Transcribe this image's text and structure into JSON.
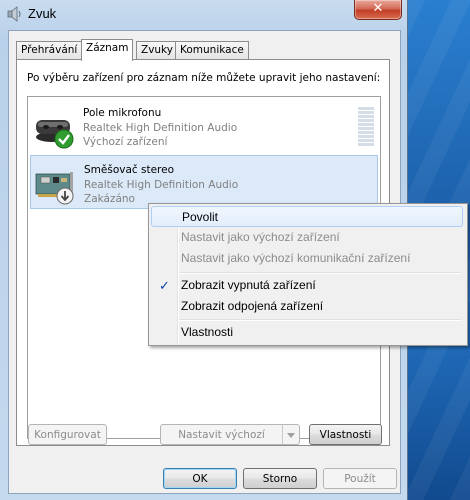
{
  "window": {
    "title": "Zvuk",
    "close_label": "✕"
  },
  "tabs": [
    {
      "label": "Přehrávání",
      "active": false
    },
    {
      "label": "Záznam",
      "active": true
    },
    {
      "label": "Zvuky",
      "active": false
    },
    {
      "label": "Komunikace",
      "active": false
    }
  ],
  "panel": {
    "instructions": "Po výběru zařízení pro záznam níže můžete upravit jeho nastavení:"
  },
  "devices": [
    {
      "name": "Pole mikrofonu",
      "driver": "Realtek High Definition Audio",
      "status": "Výchozí zařízení",
      "icon": "microphone-array-icon",
      "badge": "default-check-icon"
    },
    {
      "name": "Směšovač stereo",
      "driver": "Realtek High Definition Audio",
      "status": "Zakázáno",
      "icon": "sound-card-icon",
      "badge": "disabled-arrow-icon",
      "selected": true
    }
  ],
  "buttons": {
    "configure": "Konfigurovat",
    "set_default": "Nastavit výchozí",
    "properties": "Vlastnosti",
    "ok": "OK",
    "cancel": "Storno",
    "apply": "Použít"
  },
  "context_menu": {
    "items": [
      {
        "label": "Povolit",
        "enabled": true,
        "highlighted": true
      },
      {
        "label": "Nastavit jako výchozí zařízení",
        "enabled": false
      },
      {
        "label": "Nastavit jako výchozí komunikační zařízení",
        "enabled": false
      },
      {
        "label": "Zobrazit vypnutá zařízení",
        "enabled": true,
        "checked": true,
        "check": "✓"
      },
      {
        "label": "Zobrazit odpojená zařízení",
        "enabled": true
      },
      {
        "label": "Vlastnosti",
        "enabled": true
      }
    ]
  },
  "colors": {
    "selection": "#dbe9f8",
    "check": "#0d42a8",
    "close": "#c13d25"
  }
}
